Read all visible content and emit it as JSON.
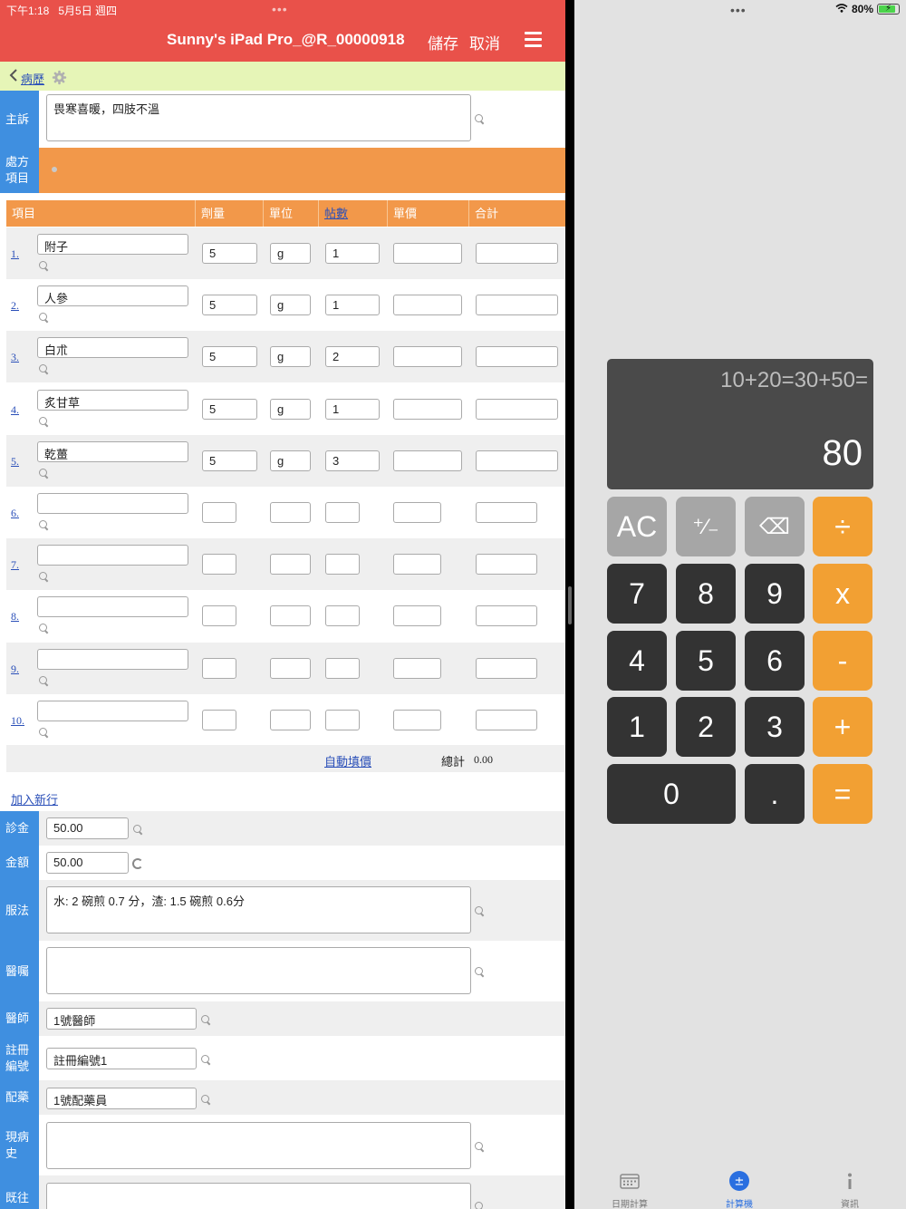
{
  "status": {
    "time": "下午1:18",
    "date": "5月5日 週四",
    "battery": "80%"
  },
  "nav": {
    "title": "Sunny's iPad Pro_@R_00000918",
    "save": "儲存",
    "cancel": "取消"
  },
  "breadcrumb": {
    "back": "病歷"
  },
  "labels": {
    "complaint": "主訴",
    "rx": "處方項目",
    "fee": "診金",
    "amount": "金額",
    "usage": "服法",
    "advice": "醫囑",
    "doctor": "醫師",
    "reg": "註冊編號",
    "dispense": "配藥",
    "history": "現病史",
    "past": "既往"
  },
  "complaint": {
    "value": "畏寒喜暖，四肢不溫"
  },
  "table": {
    "headers": [
      "項目",
      "劑量",
      "單位",
      "帖數",
      "單價",
      "合計"
    ],
    "rows": [
      {
        "num": "1.",
        "item": "附子",
        "dose": "5",
        "unit": "g",
        "packs": "1"
      },
      {
        "num": "2.",
        "item": "人參",
        "dose": "5",
        "unit": "g",
        "packs": "1"
      },
      {
        "num": "3.",
        "item": "白朮",
        "dose": "5",
        "unit": "g",
        "packs": "2"
      },
      {
        "num": "4.",
        "item": "炙甘草",
        "dose": "5",
        "unit": "g",
        "packs": "1"
      },
      {
        "num": "5.",
        "item": "乾薑",
        "dose": "5",
        "unit": "g",
        "packs": "3"
      },
      {
        "num": "6.",
        "item": "",
        "dose": "",
        "unit": "",
        "packs": ""
      },
      {
        "num": "7.",
        "item": "",
        "dose": "",
        "unit": "",
        "packs": ""
      },
      {
        "num": "8.",
        "item": "",
        "dose": "",
        "unit": "",
        "packs": ""
      },
      {
        "num": "9.",
        "item": "",
        "dose": "",
        "unit": "",
        "packs": ""
      },
      {
        "num": "10.",
        "item": "",
        "dose": "",
        "unit": "",
        "packs": ""
      }
    ],
    "auto_fill": "自動填價",
    "total_label": "總計",
    "total_value": "0.00",
    "add_row": "加入新行"
  },
  "fields": {
    "fee": "50.00",
    "amount": "50.00",
    "usage": "水: 2 碗煎 0.7 分，渣: 1.5 碗煎 0.6分",
    "advice": "",
    "doctor": "1號醫師",
    "reg": "註冊編號1",
    "dispense": "1號配藥員",
    "history": "",
    "past": ""
  },
  "calculator": {
    "expression": "10+20=30+50=",
    "result": "80",
    "keys": [
      "AC",
      "⁺∕₋",
      "⌫",
      "÷",
      "7",
      "8",
      "9",
      "x",
      "4",
      "5",
      "6",
      "-",
      "1",
      "2",
      "3",
      "+",
      "0",
      ".",
      "="
    ]
  },
  "tabs": [
    {
      "label": "日期計算",
      "icon": "calendar-icon"
    },
    {
      "label": "計算機",
      "icon": "plus-minus-icon"
    },
    {
      "label": "資訊",
      "icon": "info-icon"
    }
  ],
  "colors": {
    "nav": "#e9514a",
    "label": "#3f8fe0",
    "orange": "#f2984a",
    "breadcrumb": "#e6f5b7",
    "link": "#2a4fb8",
    "calc_op": "#f2a033"
  }
}
